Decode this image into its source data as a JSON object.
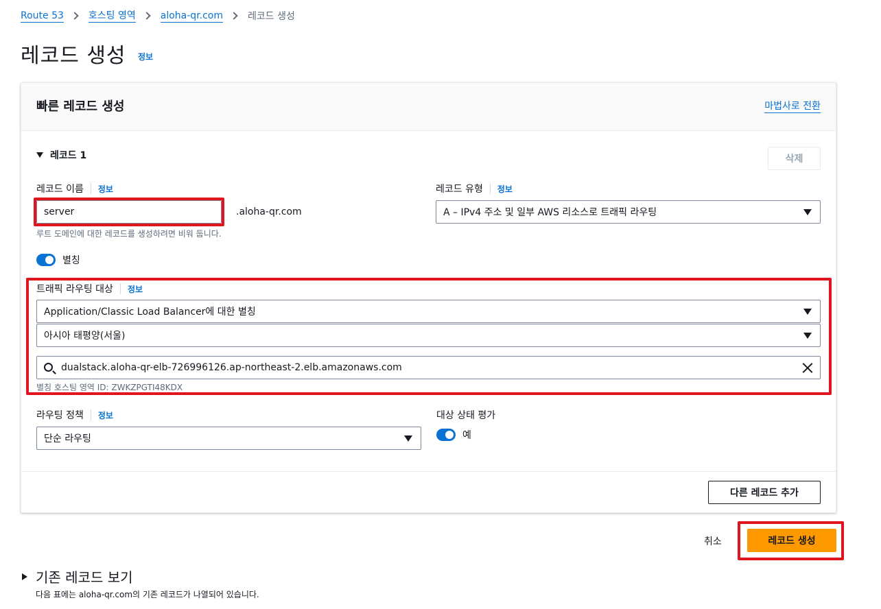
{
  "breadcrumb": {
    "items": [
      "Route 53",
      "호스팅 영역",
      "aloha-qr.com"
    ],
    "current": "레코드 생성"
  },
  "page": {
    "title": "레코드 생성",
    "info": "정보"
  },
  "panel": {
    "title": "빠른 레코드 생성",
    "wizard_link": "마법사로 전환",
    "record_title": "레코드 1",
    "delete_button": "삭제",
    "record_name": {
      "label": "레코드 이름",
      "info": "정보",
      "value": "server",
      "suffix": ".aloha-qr.com",
      "hint": "루트 도메인에 대한 레코드를 생성하려면 비워 둡니다."
    },
    "record_type": {
      "label": "레코드 유형",
      "info": "정보",
      "value": "A – IPv4 주소 및 일부 AWS 리소스로 트래픽 라우팅"
    },
    "alias": {
      "label": "별칭",
      "enabled": true
    },
    "traffic_target": {
      "label": "트래픽 라우팅 대상",
      "info": "정보",
      "endpoint": "Application/Classic Load Balancer에 대한 별칭",
      "region": "아시아 태평양(서울)",
      "load_balancer": "dualstack.aloha-qr-elb-726996126.ap-northeast-2.elb.amazonaws.com",
      "hosted_zone_hint": "별칭 호스팅 영역 ID: ZWKZPGTI48KDX"
    },
    "routing_policy": {
      "label": "라우팅 정책",
      "info": "정보",
      "value": "단순 라우팅"
    },
    "health_evaluation": {
      "label": "대상 상태 평가",
      "value_label": "예",
      "enabled": true
    },
    "add_record_button": "다른 레코드 추가"
  },
  "actions": {
    "cancel": "취소",
    "create": "레코드 생성"
  },
  "existing_records": {
    "title": "기존 레코드 보기",
    "description": "다음 표에는 aloha-qr.com의 기존 레코드가 나열되어 있습니다."
  },
  "colors": {
    "accent": "#0972d3",
    "primary_button": "#ff9900",
    "highlight_border": "#e0161e"
  }
}
